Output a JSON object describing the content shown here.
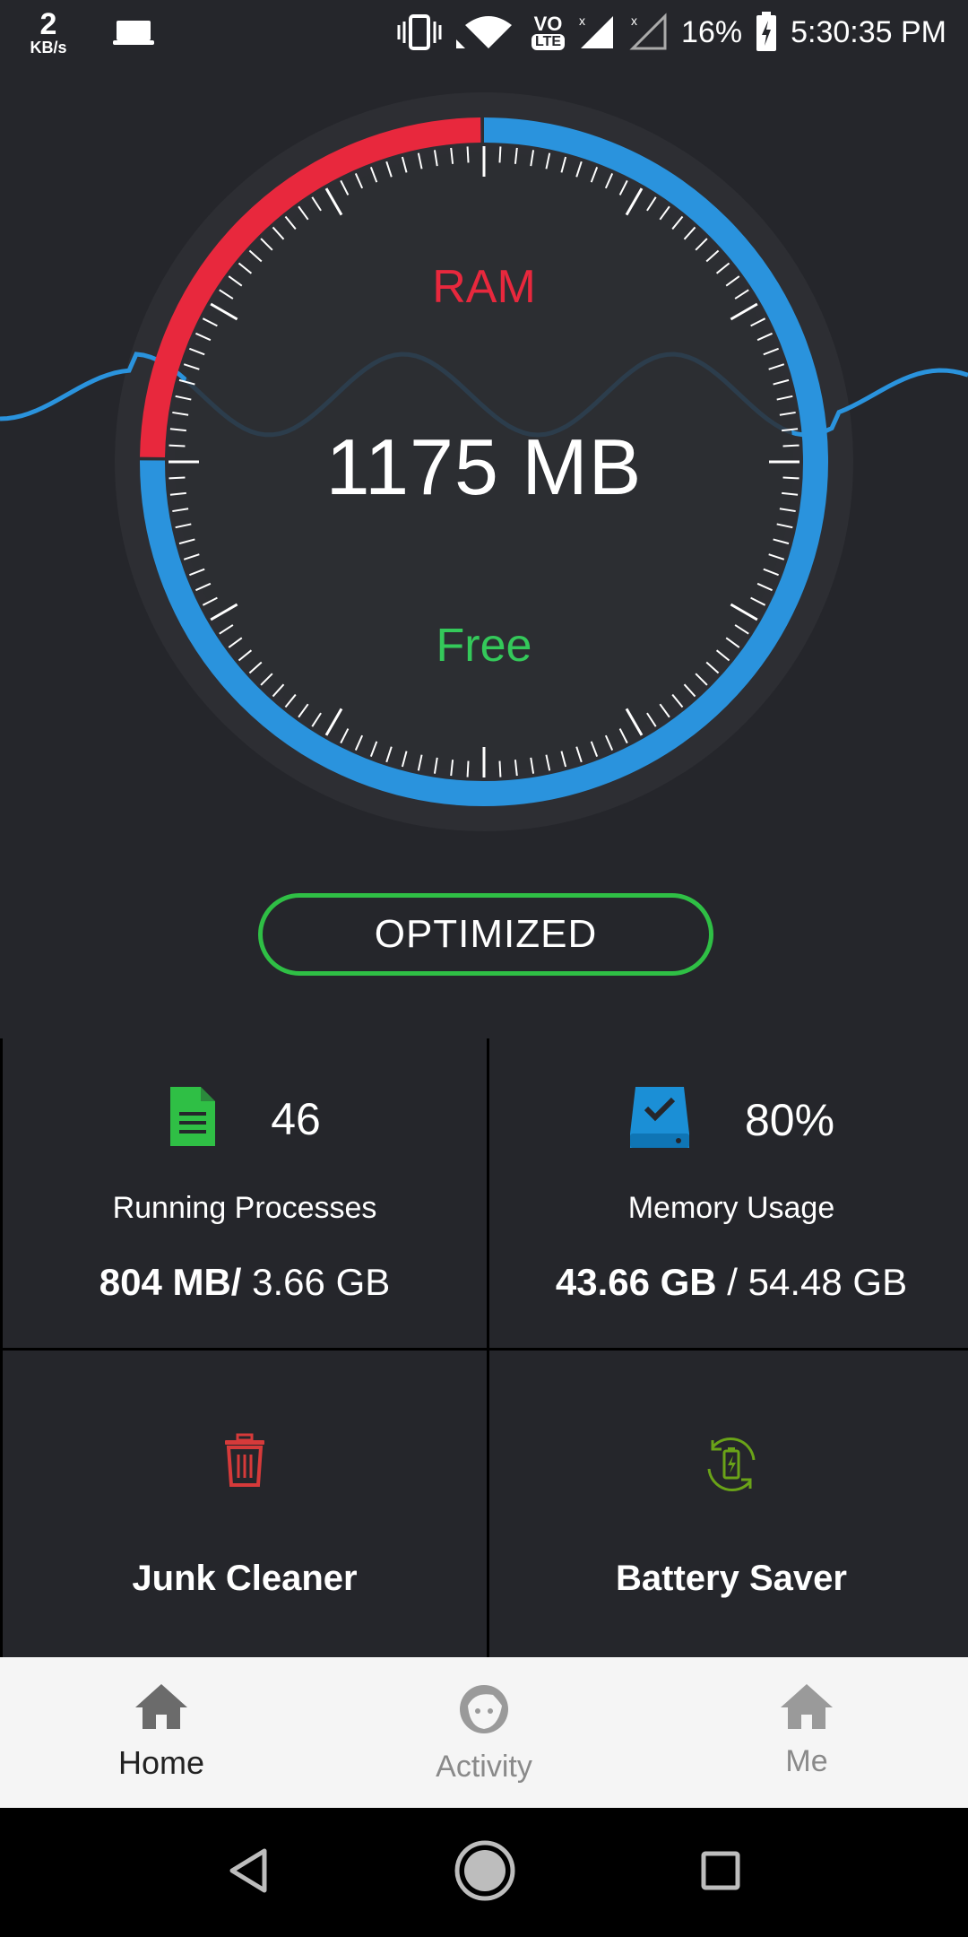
{
  "status_bar": {
    "net_speed": "2",
    "net_unit": "KB/s",
    "battery_percent": "16%",
    "time": "5:30:35 PM",
    "lte": "LTE",
    "vo": "VO"
  },
  "gauge": {
    "title": "RAM",
    "value": "1175 MB",
    "state": "Free",
    "used_fraction": 0.2,
    "colors": {
      "used": "#e8283d",
      "free": "#2a93dd",
      "ring_bg": "#2d2e33",
      "wave": "#2a93dd"
    }
  },
  "optimize_button": "OPTIMIZED",
  "stats": {
    "processes": {
      "count": "46",
      "label": "Running Processes",
      "used": "804 MB/",
      "total": " 3.66 GB"
    },
    "memory": {
      "percent": "80%",
      "label": "Memory Usage",
      "used": "43.66 GB",
      "separator": " / ",
      "total": "54.48 GB"
    }
  },
  "tools": {
    "junk": {
      "label": "Junk Cleaner"
    },
    "battery": {
      "label": "Battery Saver"
    }
  },
  "bottom_nav": {
    "home": "Home",
    "activity": "Activity",
    "me": "Me"
  },
  "icons": {
    "processes": "document-icon",
    "memory": "storage-check-icon",
    "junk": "trash-icon",
    "battery": "battery-cycle-icon"
  }
}
